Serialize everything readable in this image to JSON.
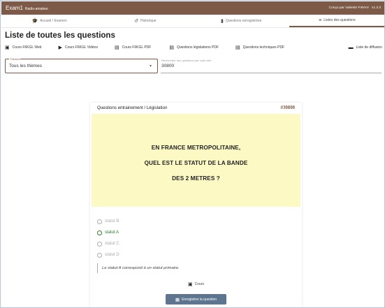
{
  "app": {
    "name": "Exam1",
    "subtitle": "Radio-amateur",
    "credits": "Conçu par Valentin F4HVV",
    "version": "v1.3.3"
  },
  "tabs": [
    {
      "label": "Accueil / Examen",
      "icon": "graduation-cap-icon"
    },
    {
      "label": "Historique",
      "icon": "history-icon"
    },
    {
      "label": "Questions enregistrées",
      "icon": "bookmark-icon"
    },
    {
      "label": "Listes des questions",
      "icon": "list-icon",
      "active": true
    }
  ],
  "page": {
    "title": "Liste de toutes les questions"
  },
  "links": [
    {
      "label": "Cours F6KGL Web",
      "icon": "external-link-icon"
    },
    {
      "label": "Cours F6KGL Vidéos",
      "icon": "video-icon"
    },
    {
      "label": "Cours F6KGL PDF",
      "icon": "pdf-icon"
    },
    {
      "label": "Questions législations PDF",
      "icon": "pdf-icon"
    },
    {
      "label": "Questions techniques PDF",
      "icon": "pdf-icon"
    },
    {
      "label": "Liste de diffusion",
      "icon": "message-icon"
    }
  ],
  "filters": {
    "theme_label": "Thèmes",
    "theme_value": "Tous les thèmes",
    "search_label": "Rechercher des questions par mots clés",
    "search_value": "30800"
  },
  "question": {
    "category": "Questions entrainement / Législation",
    "id": "#30800",
    "lines": [
      "EN FRANCE METROPOLITAINE,",
      "QUEL EST LE STATUT DE LA BANDE",
      "DES 2 METRES ?"
    ],
    "answers": [
      {
        "label": "statut B",
        "correct": false
      },
      {
        "label": "statut A",
        "correct": true
      },
      {
        "label": "statut C",
        "correct": false
      },
      {
        "label": "statut D",
        "correct": false
      }
    ],
    "note": "Le statut A correspond à un statut primaire.",
    "cours_label": "Cours",
    "save_label": "Enregistrer la question"
  },
  "colors": {
    "brand": "#7d5a48",
    "highlight": "#fcf9c5",
    "correct": "#2d7a2d",
    "button": "#5e7590"
  }
}
